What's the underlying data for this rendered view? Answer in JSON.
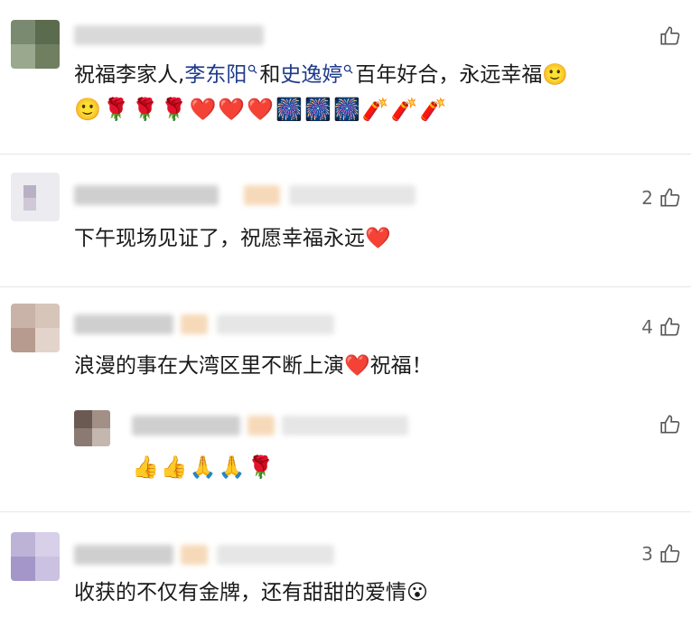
{
  "comments": [
    {
      "likes": "",
      "text_before": "祝福李家人,",
      "mention1": "李东阳",
      "middle": "和",
      "mention2": "史逸婷",
      "text_after": "百年好合，永远幸福",
      "emoji_line1": "🙂",
      "emoji_line2": "🙂🌹🌹🌹❤️❤️❤️🎆🎆🎆🧨🧨🧨"
    },
    {
      "likes": "2",
      "text": "下午现场见证了，祝愿幸福永远❤️"
    },
    {
      "likes": "4",
      "text": "浪漫的事在大湾区里不断上演❤️祝福！"
    },
    {
      "likes": "",
      "reply_emoji": "👍👍🙏🙏🌹"
    },
    {
      "likes": "3",
      "text": "收获的不仅有金牌，还有甜甜的爱情😮"
    }
  ],
  "colors": {
    "mention": "#1e3a8a",
    "divider": "#e6e6e6",
    "like": "#666666"
  },
  "icons": [
    "thumbs-up-icon",
    "search-mini-icon"
  ]
}
